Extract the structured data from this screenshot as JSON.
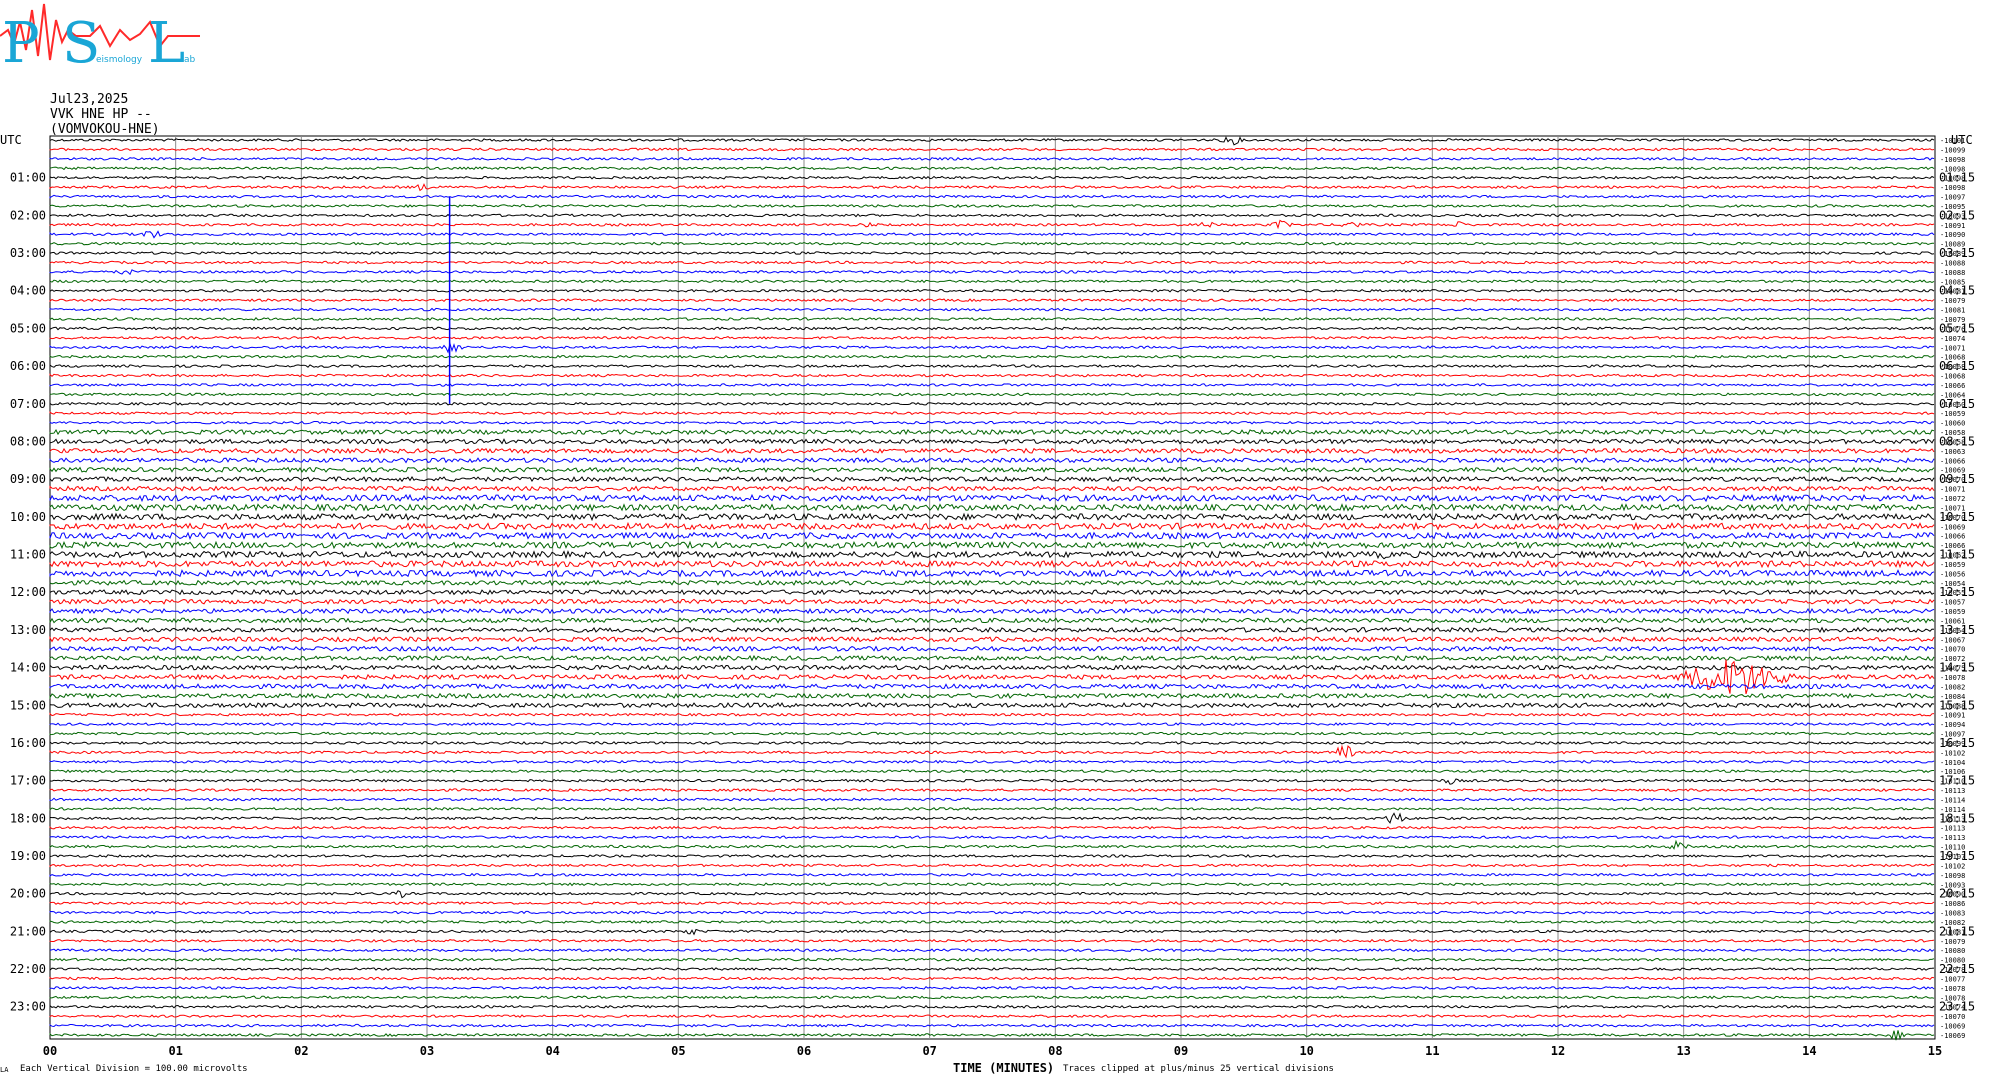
{
  "logo": {
    "letters": [
      "P",
      "S",
      "L"
    ],
    "small_text": [
      "eismology",
      "ab"
    ],
    "colors": {
      "letters": "#1aa6d6",
      "wave": "#ff2a2a"
    }
  },
  "header": {
    "date": "Jul23,2025",
    "channel": "VVK HNE HP --",
    "station": "(VOMVOKOU-HNE)"
  },
  "chart_data": {
    "type": "line",
    "title": "",
    "left_axis_label": "UTC",
    "right_axis_label": "UTC",
    "hour_labels_left": [
      "01:00",
      "02:00",
      "03:00",
      "04:00",
      "05:00",
      "06:00",
      "07:00",
      "08:00",
      "09:00",
      "10:00",
      "11:00",
      "12:00",
      "13:00",
      "14:00",
      "15:00",
      "16:00",
      "17:00",
      "18:00",
      "19:00",
      "20:00",
      "21:00",
      "22:00",
      "23:00"
    ],
    "hour_labels_right": [
      "01:15",
      "02:15",
      "03:15",
      "04:15",
      "05:15",
      "06:15",
      "07:15",
      "08:15",
      "09:15",
      "10:15",
      "11:15",
      "12:15",
      "13:15",
      "14:15",
      "15:15",
      "16:15",
      "17:15",
      "18:15",
      "19:15",
      "20:15",
      "21:15",
      "22:15",
      "23:15"
    ],
    "x_ticks": [
      "00",
      "01",
      "02",
      "03",
      "04",
      "05",
      "06",
      "07",
      "08",
      "09",
      "10",
      "11",
      "12",
      "13",
      "14",
      "15"
    ],
    "xlabel": "TIME (MINUTES)",
    "xlim": [
      0,
      15
    ],
    "trace_count": 96,
    "trace_minutes": 15,
    "trace_colors": [
      "#000000",
      "#ff0000",
      "#0000ff",
      "#006400"
    ],
    "grid": "vertical lines at each minute",
    "offsets": [
      "-10101",
      "-10099",
      "-10098",
      "-10098",
      "-10098",
      "-10098",
      "-10097",
      "-10095",
      "-10093",
      "-10091",
      "-10090",
      "-10089",
      "-10089",
      "-10088",
      "-10088",
      "-10085",
      "-10081",
      "-10079",
      "-10081",
      "-10079",
      "-10076",
      "-10074",
      "-10071",
      "-10068",
      "-10068",
      "-10068",
      "-10066",
      "-10064",
      "-10060",
      "-10059",
      "-10060",
      "-10058",
      "-10058",
      "-10063",
      "-10066",
      "-10069",
      "-10070",
      "-10071",
      "-10072",
      "-10071",
      "-10070",
      "-10069",
      "-10066",
      "-10066",
      "-10062",
      "-10059",
      "-10056",
      "-10054",
      "-10055",
      "-10057",
      "-10059",
      "-10061",
      "-10064",
      "-10067",
      "-10070",
      "-10072",
      "-10075",
      "-10078",
      "-10082",
      "-10084",
      "-10088",
      "-10091",
      "-10094",
      "-10097",
      "-10099",
      "-10102",
      "-10104",
      "-10106",
      "-10110",
      "-10113",
      "-10114",
      "-10114",
      "-10113",
      "-10113",
      "-10113",
      "-10110",
      "-10107",
      "-10102",
      "-10098",
      "-10093",
      "-10090",
      "-10086",
      "-10083",
      "-10082",
      "-10081",
      "-10079",
      "-10080",
      "-10080",
      "-10078",
      "-10077",
      "-10078",
      "-10078",
      "-10074",
      "-10070",
      "-10069",
      "-10069"
    ],
    "events": [
      {
        "trace": 0,
        "minute": 9.4,
        "amp": 6
      },
      {
        "trace": 5,
        "minute": 2.2,
        "amp": 3
      },
      {
        "trace": 5,
        "minute": 2.95,
        "amp": 4
      },
      {
        "trace": 9,
        "minute": 6.5,
        "amp": 3
      },
      {
        "trace": 9,
        "minute": 9.2,
        "amp": 4
      },
      {
        "trace": 9,
        "minute": 9.8,
        "amp": 5
      },
      {
        "trace": 9,
        "minute": 10.35,
        "amp": 5
      },
      {
        "trace": 9,
        "minute": 11.2,
        "amp": 4
      },
      {
        "trace": 10,
        "minute": 0.8,
        "amp": 6
      },
      {
        "trace": 14,
        "minute": 0.6,
        "amp": 4
      },
      {
        "trace": 22,
        "minute": 3.2,
        "amp": 7
      },
      {
        "trace": 41,
        "minute": 6.9,
        "amp": 5
      },
      {
        "trace": 43,
        "minute": 6.6,
        "amp": 5
      },
      {
        "trace": 44,
        "minute": 10.6,
        "amp": 5
      },
      {
        "trace": 57,
        "minute": 13.4,
        "amp": 22,
        "wide": true
      },
      {
        "trace": 65,
        "minute": 10.3,
        "amp": 9
      },
      {
        "trace": 68,
        "minute": 11.15,
        "amp": 4
      },
      {
        "trace": 72,
        "minute": 10.7,
        "amp": 8
      },
      {
        "trace": 75,
        "minute": 12.95,
        "amp": 6
      },
      {
        "trace": 80,
        "minute": 2.8,
        "amp": 4
      },
      {
        "trace": 84,
        "minute": 5.1,
        "amp": 4
      },
      {
        "trace": 95,
        "minute": 14.7,
        "amp": 6
      }
    ],
    "spike": {
      "minute": 3.18,
      "from_trace": 6,
      "to_trace": 28,
      "color": "#0000ff"
    }
  },
  "footer": {
    "scale_note": "Each Vertical Division =  100.00 microvolts",
    "clip_note": "Traces clipped at plus/minus 25 vertical divisions",
    "mark": "LA"
  }
}
